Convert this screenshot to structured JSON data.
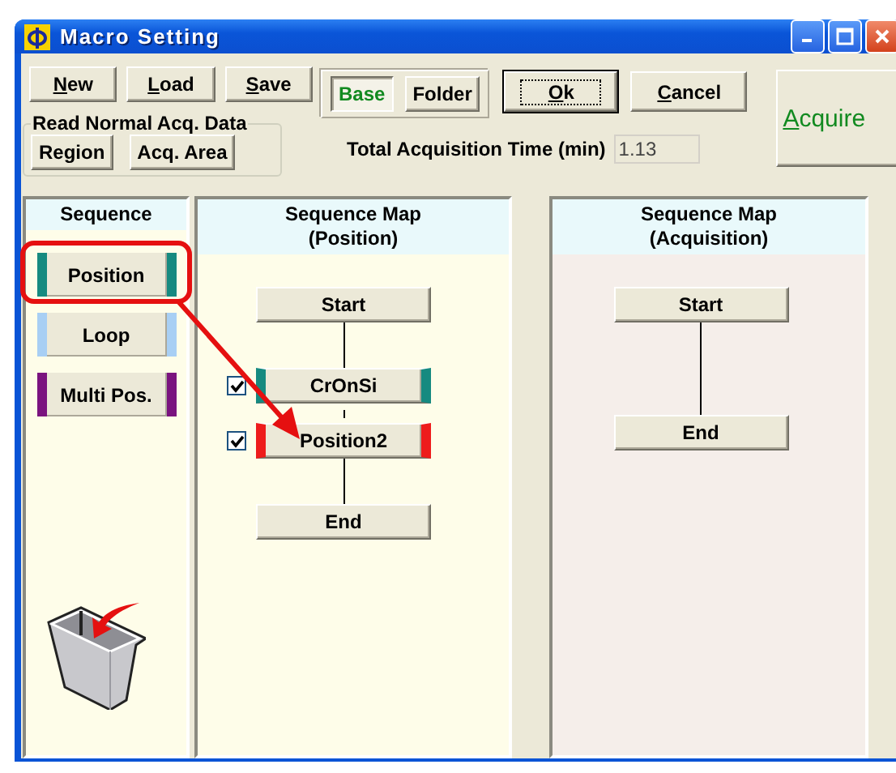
{
  "window": {
    "title": "Macro Setting"
  },
  "toolbar": {
    "file_buttons": [
      {
        "label": "New"
      },
      {
        "label": "Load"
      },
      {
        "label": "Save"
      }
    ],
    "view_toggle": [
      {
        "label": "Base",
        "selected": true
      },
      {
        "label": "Folder",
        "selected": false
      }
    ],
    "ok": "Ok",
    "cancel": "Cancel",
    "acquire": "Acquire",
    "read_group": {
      "title": "Read Normal Acq. Data",
      "buttons": [
        "Region",
        "Acq. Area"
      ]
    },
    "total_time": {
      "label": "Total Acquisition Time (min)",
      "value": "1.13"
    }
  },
  "sequence_panel": {
    "title": "Sequence",
    "items": [
      {
        "label": "Position",
        "color": "#168a80"
      },
      {
        "label": "Loop",
        "color": "#a8cff4"
      },
      {
        "label": "Multi Pos.",
        "color": "#7a137f"
      }
    ]
  },
  "position_map": {
    "title": "Sequence Map",
    "subtitle": "(Position)",
    "nodes": [
      {
        "kind": "terminal",
        "label": "Start"
      },
      {
        "kind": "step",
        "label": "CrOnSi",
        "checked": true,
        "color": "#168a80"
      },
      {
        "kind": "step",
        "label": "Position2",
        "checked": true,
        "color": "#ee1c1c"
      },
      {
        "kind": "terminal",
        "label": "End"
      }
    ]
  },
  "acquisition_map": {
    "title": "Sequence Map",
    "subtitle": "(Acquisition)",
    "nodes": [
      {
        "kind": "terminal",
        "label": "Start"
      },
      {
        "kind": "terminal",
        "label": "End"
      }
    ]
  }
}
